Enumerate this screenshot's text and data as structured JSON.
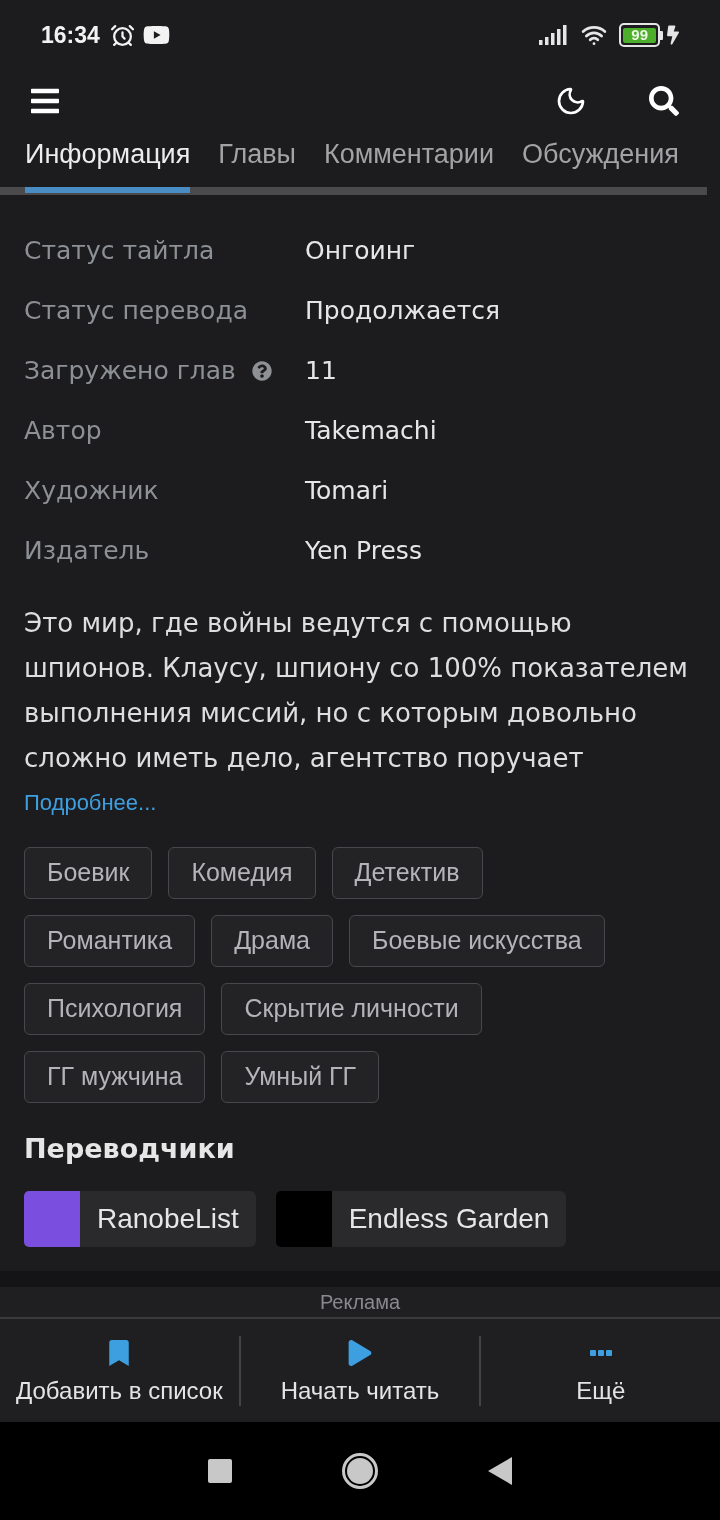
{
  "status_bar": {
    "time": "16:34",
    "battery": "99"
  },
  "tabs": [
    {
      "label": "Информация",
      "selected": true
    },
    {
      "label": "Главы",
      "selected": false
    },
    {
      "label": "Комментарии",
      "selected": false
    },
    {
      "label": "Обсуждения",
      "selected": false
    }
  ],
  "info": [
    {
      "label": "Статус тайтла",
      "value": "Онгоинг",
      "help": false
    },
    {
      "label": "Статус перевода",
      "value": "Продолжается",
      "help": false
    },
    {
      "label": "Загружено глав",
      "value": "11",
      "help": true
    },
    {
      "label": "Автор",
      "value": "Takemachi",
      "help": false
    },
    {
      "label": "Художник",
      "value": "Tomari",
      "help": false
    },
    {
      "label": "Издатель",
      "value": "Yen Press",
      "help": false
    }
  ],
  "description": {
    "text": "Это мир, где войны ведутся с помощью шпионов. Клаусу, шпиону со 100% показателем выполнения миссий, но с которым довольно сложно иметь дело, агентство поручает",
    "more_link": "Подробнее..."
  },
  "tags": [
    "Боевик",
    "Комедия",
    "Детектив",
    "Романтика",
    "Драма",
    "Боевые искусства",
    "Психология",
    "Скрытие личности",
    "ГГ мужчина",
    "Умный ГГ"
  ],
  "translators": {
    "heading": "Переводчики",
    "items": [
      {
        "name": "RanobeList",
        "color": "#7a4fe0"
      },
      {
        "name": "Endless Garden",
        "color": "#000000"
      }
    ]
  },
  "ad": {
    "label": "Реклама"
  },
  "bottom_bar": [
    {
      "label": "Добавить в список",
      "kind": "bookmark"
    },
    {
      "label": "Начать читать",
      "kind": "play"
    },
    {
      "label": "Ещё",
      "kind": "more"
    }
  ]
}
